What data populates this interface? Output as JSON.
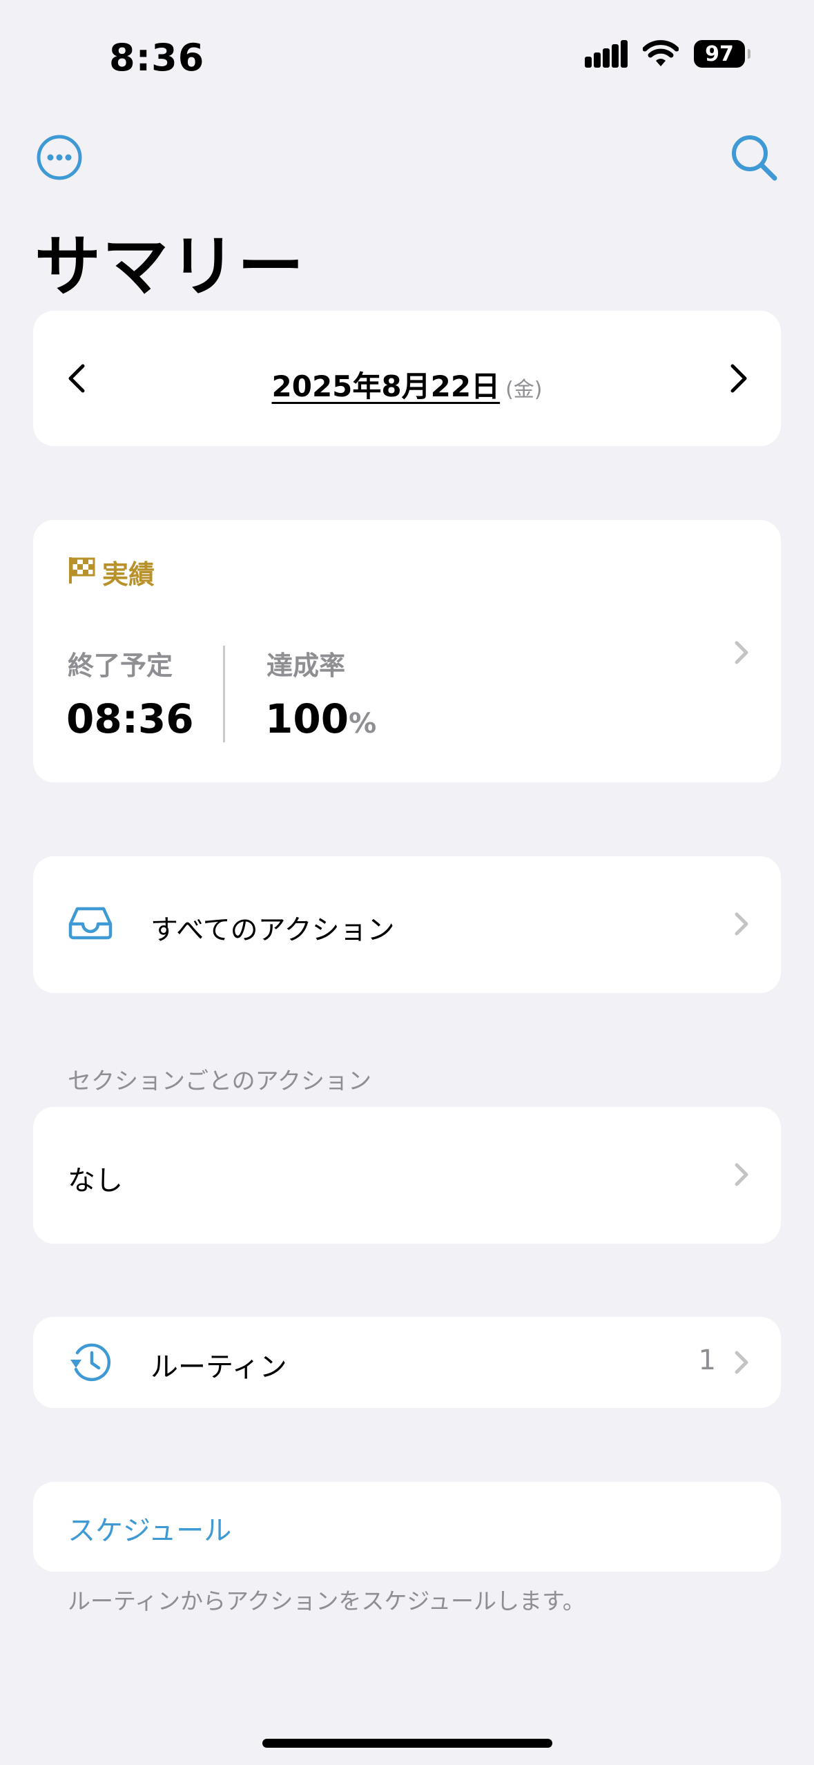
{
  "status_bar": {
    "time": "8:36",
    "battery": "97"
  },
  "header": {
    "title": "サマリー"
  },
  "date_nav": {
    "date": "2025年8月22日",
    "weekday": "(金)"
  },
  "achievement": {
    "title": "実績",
    "end_label": "終了予定",
    "end_value": "08:36",
    "rate_label": "達成率",
    "rate_value": "100",
    "rate_unit": "%"
  },
  "all_actions": {
    "label": "すべてのアクション"
  },
  "section_actions": {
    "header": "セクションごとのアクション",
    "value": "なし"
  },
  "routine": {
    "label": "ルーティン",
    "count": "1"
  },
  "schedule": {
    "label": "スケジュール",
    "note": "ルーティンからアクションをスケジュールします。"
  },
  "colors": {
    "accent": "#3e99d4",
    "gold": "#b8912b",
    "background": "#f2f1f6"
  }
}
